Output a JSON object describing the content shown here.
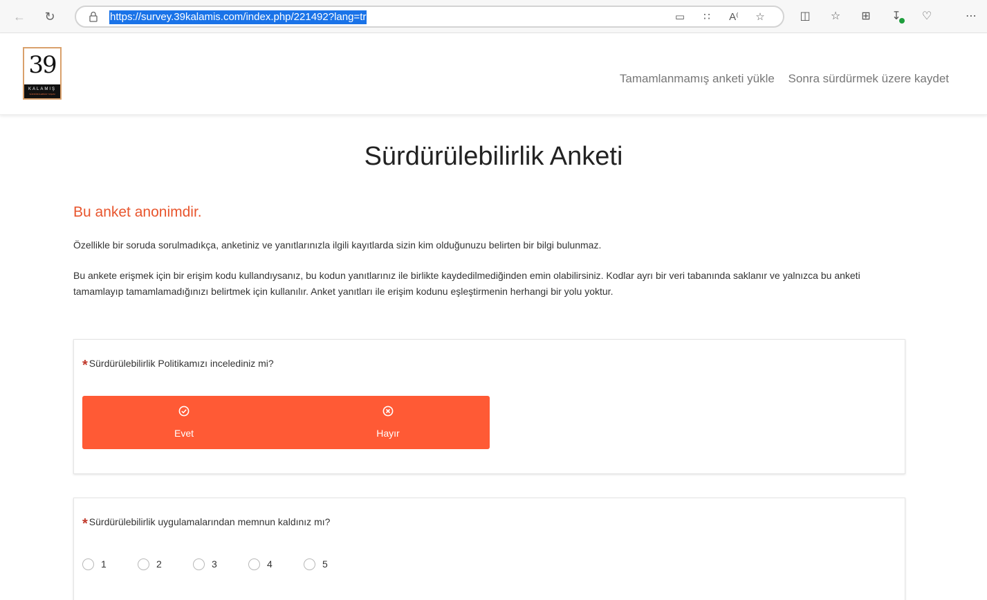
{
  "browser": {
    "url": "https://survey.39kalamis.com/index.php/221492?lang=tr",
    "icons": [
      "back-icon",
      "reload-icon",
      "lock-icon",
      "app-available-icon",
      "grid-icon",
      "read-aloud-icon",
      "favorite-star-icon",
      "split-screen-icon",
      "favorites-icon",
      "collections-icon",
      "downloads-icon",
      "browser-essentials-icon",
      "more-icon"
    ]
  },
  "header": {
    "logo_text": "39",
    "logo_band": "KALAMIŞ",
    "logo_sub": "SÜRDÜRÜLEBİLİR YAŞAM",
    "link_load": "Tamamlanmamış anketi yükle",
    "link_save": "Sonra sürdürmek üzere kaydet"
  },
  "survey": {
    "title": "Sürdürülebilirlik Anketi",
    "anon_heading": "Bu anket anonimdir.",
    "para1": "Özellikle bir soruda sorulmadıkça, anketiniz ve yanıtlarınızla ilgili kayıtlarda sizin kim olduğunuzu belirten bir bilgi bulunmaz.",
    "para2": "Bu ankete erişmek için bir erişim kodu kullandıysanız, bu kodun yanıtlarınız ile birlikte kaydedilmediğinden emin olabilirsiniz. Kodlar ayrı bir veri tabanında saklanır ve yalnızca bu anketi tamamlayıp tamamlamadığınızı belirtmek için kullanılır. Anket yanıtları ile erişim kodunu eşleştirmenin herhangi bir yolu yoktur."
  },
  "q1": {
    "required_mark": "*",
    "text": "Sürdürülebilirlik Politikamızı incelediniz mi?",
    "yes_label": "Evet",
    "no_label": "Hayır"
  },
  "q2": {
    "required_mark": "*",
    "text": "Sürdürülebilirlik uygulamalarından memnun kaldınız mı?",
    "options": [
      "1",
      "2",
      "3",
      "4",
      "5"
    ]
  },
  "colors": {
    "accent": "#ff5a35",
    "heading_orange": "#e8552d",
    "required_red": "#c0392b"
  }
}
